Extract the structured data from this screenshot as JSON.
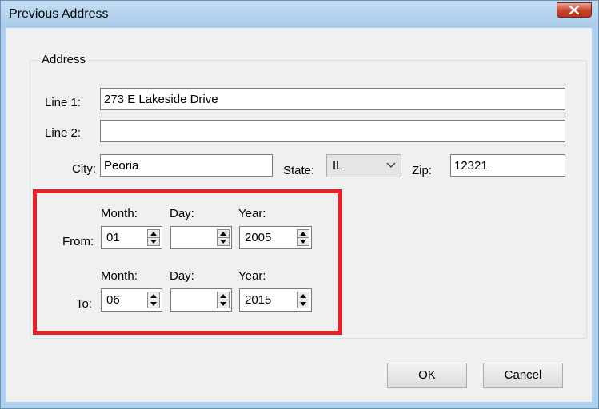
{
  "window": {
    "title": "Previous Address"
  },
  "address_group": {
    "label": "Address",
    "line1": {
      "label": "Line 1:",
      "value": "273 E Lakeside Drive"
    },
    "line2": {
      "label": "Line 2:",
      "value": ""
    },
    "city": {
      "label": "City:",
      "value": "Peoria"
    },
    "state": {
      "label": "State:",
      "value": "IL"
    },
    "zip": {
      "label": "Zip:",
      "value": "12321"
    }
  },
  "date_range": {
    "column_labels": {
      "month": "Month:",
      "day": "Day:",
      "year": "Year:"
    },
    "from": {
      "label": "From:",
      "month": "01",
      "day": "",
      "year": "2005"
    },
    "to": {
      "label": "To:",
      "month": "06",
      "day": "",
      "year": "2015"
    }
  },
  "buttons": {
    "ok": "OK",
    "cancel": "Cancel"
  },
  "colors": {
    "highlight": "#e8202a",
    "close_button": "#c7432b",
    "title_bar": "#aecbea"
  },
  "icons": {
    "close": "close-icon",
    "dropdown": "chevron-down-icon",
    "spin_up": "spin-up-icon",
    "spin_down": "spin-down-icon"
  }
}
